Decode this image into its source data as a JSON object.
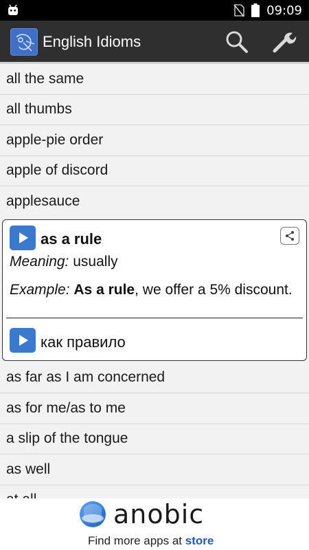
{
  "status_bar": {
    "time": "09:09",
    "icons": [
      "android-icon",
      "no-sim-icon",
      "battery-icon"
    ]
  },
  "action_bar": {
    "title": "English Idioms",
    "icons": [
      "app-logo-icon",
      "search-icon",
      "wrench-icon"
    ]
  },
  "list_before": [
    "all the same",
    "all thumbs",
    "apple-pie order",
    "apple of discord",
    "applesauce"
  ],
  "expanded": {
    "idiom": "as a rule",
    "meaning_label": "Meaning:",
    "meaning": "usually",
    "example_label": "Example:",
    "example_bold": "As a rule",
    "example_rest": ", we offer a 5% discount.",
    "translation": "как правило",
    "icons": [
      "play-icon",
      "share-icon"
    ]
  },
  "list_after": [
    "as far as I am concerned",
    "as for me/as to me",
    "a slip of the tongue",
    "as well",
    "at all"
  ],
  "ad": {
    "brand": "anobic",
    "tagline": "Find more apps at ",
    "tagline_link": "store"
  },
  "colors": {
    "action_bar": "#2f2f2f",
    "play_button": "#3b79cf",
    "ad_link": "#1e5bbf"
  }
}
